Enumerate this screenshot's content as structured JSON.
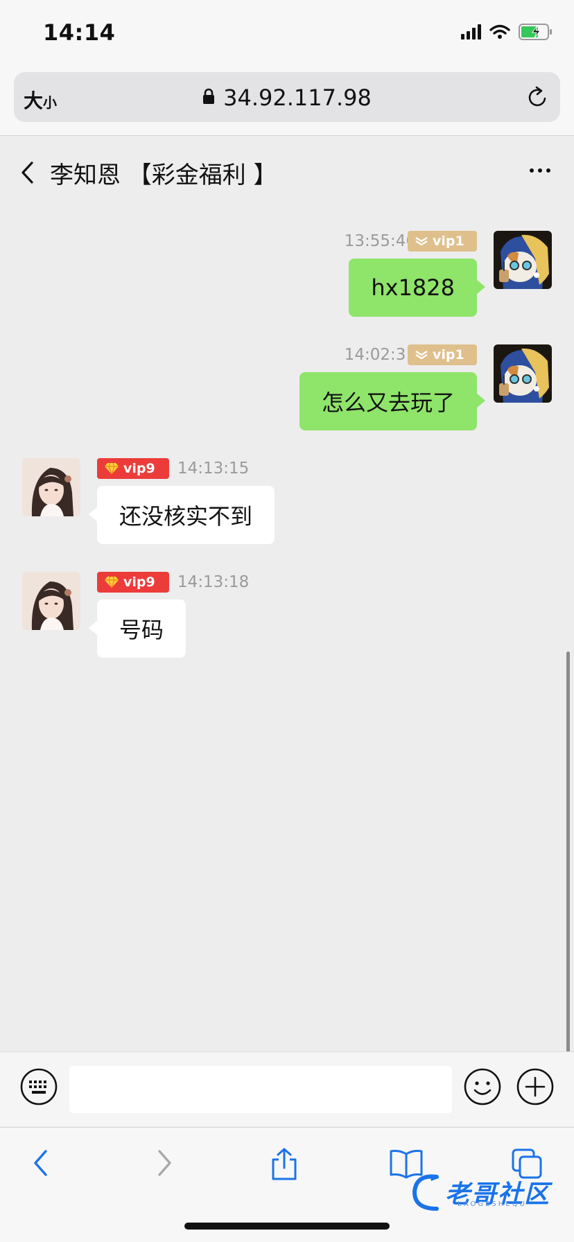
{
  "status_bar": {
    "time": "14:14"
  },
  "browser": {
    "text_size_big": "大",
    "text_size_small": "小",
    "url": "34.92.117.98"
  },
  "chat": {
    "title": "李知恩 【彩金福利 】",
    "messages": [
      {
        "side": "right",
        "time": "13:55:46",
        "vip": "vip1",
        "text": "hx1828"
      },
      {
        "side": "right",
        "time": "14:02:31",
        "vip": "vip1",
        "text": "怎么又去玩了"
      },
      {
        "side": "left",
        "time": "14:13:15",
        "vip": "vip9",
        "text": "还没核实不到"
      },
      {
        "side": "left",
        "time": "14:13:18",
        "vip": "vip9",
        "text": "号码"
      }
    ]
  },
  "input": {
    "placeholder": ""
  },
  "watermark": {
    "text": "老哥社区",
    "sub": "LAOGESHEQU"
  },
  "colors": {
    "bubble_self": "#8fe46a",
    "vip_gold": "#dfc08c",
    "vip_red": "#ec3c3a",
    "ios_blue": "#1a73e8"
  },
  "icons": [
    "signal-icon",
    "wifi-icon",
    "battery-icon",
    "lock-icon",
    "reload-icon",
    "back-icon",
    "more-icon",
    "keyboard-icon",
    "emoji-icon",
    "plus-icon",
    "share-icon",
    "bookmarks-icon",
    "tabs-icon"
  ]
}
